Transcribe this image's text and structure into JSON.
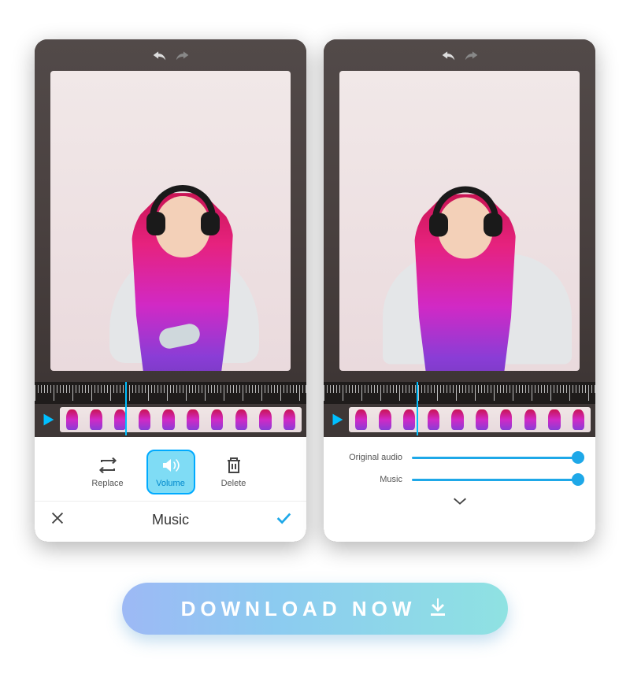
{
  "leftPanel": {
    "actions": {
      "replace": "Replace",
      "volume": "Volume",
      "delete": "Delete"
    },
    "sectionTitle": "Music"
  },
  "rightPanel": {
    "sliders": {
      "originalAudio": "Original audio",
      "music": "Music"
    }
  },
  "cta": {
    "label": "DOWNLOAD NOW"
  }
}
